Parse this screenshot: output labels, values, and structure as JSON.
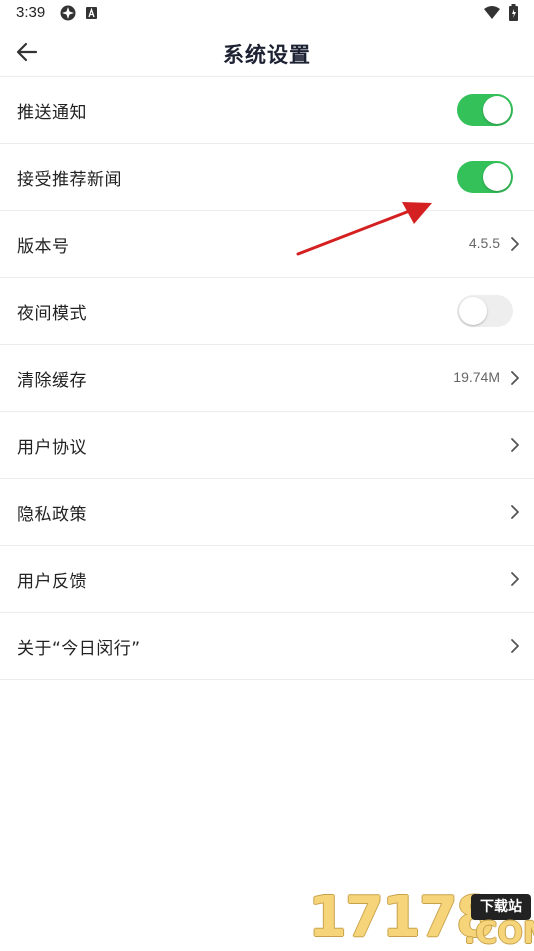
{
  "status_bar": {
    "time": "3:39",
    "icons": [
      "app-badge-icon",
      "a-letter-icon",
      "wifi-icon",
      "battery-icon"
    ]
  },
  "header": {
    "title": "系统设置",
    "back_icon": "arrow-left-icon"
  },
  "settings": {
    "items": [
      {
        "label": "推送通知",
        "type": "toggle",
        "enabled": true
      },
      {
        "label": "接受推荐新闻",
        "type": "toggle",
        "enabled": true
      },
      {
        "label": "版本号",
        "type": "value",
        "value": "4.5.5"
      },
      {
        "label": "夜间模式",
        "type": "toggle",
        "enabled": false
      },
      {
        "label": "清除缓存",
        "type": "value",
        "value": "19.74M"
      },
      {
        "label": "用户协议",
        "type": "link"
      },
      {
        "label": "隐私政策",
        "type": "link"
      },
      {
        "label": "用户反馈",
        "type": "link"
      },
      {
        "label": "关于“今日闵行”",
        "type": "link"
      }
    ]
  },
  "watermark": {
    "digits": "17178",
    "badge": "下载站",
    "domain": ".COM"
  },
  "colors": {
    "toggle_on": "#34c15a",
    "toggle_off": "#eeeeee",
    "title": "#1d2233",
    "annotation_arrow": "#d42020"
  }
}
